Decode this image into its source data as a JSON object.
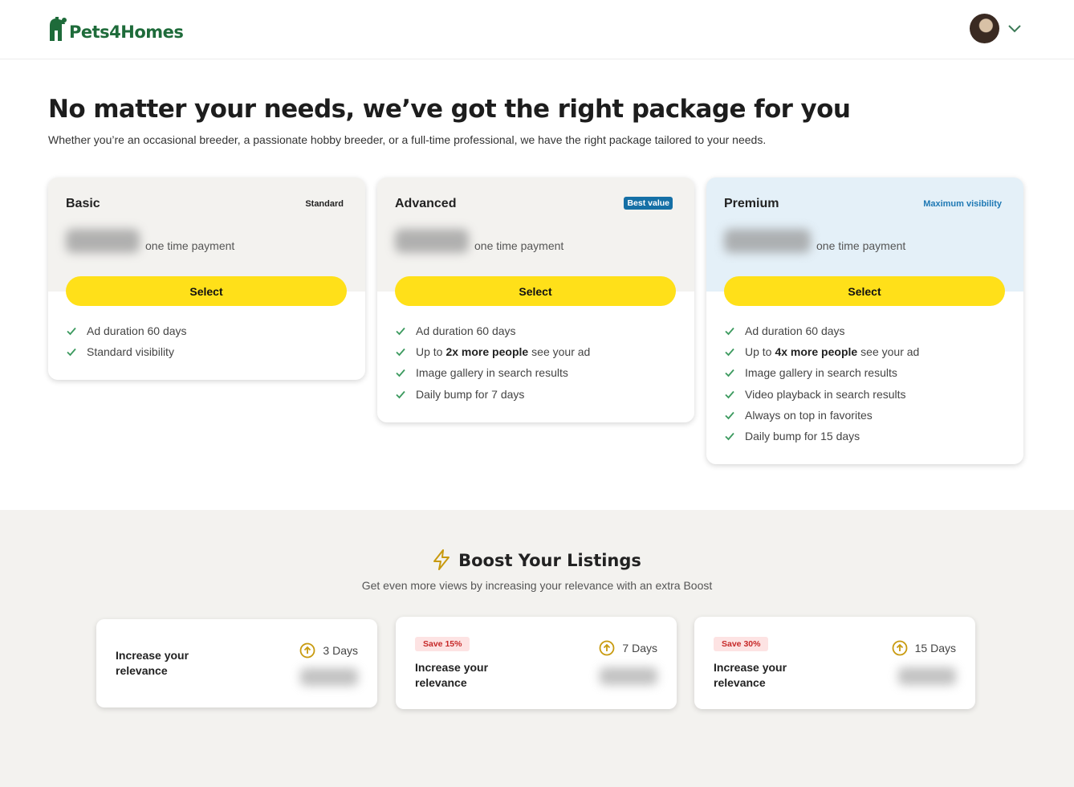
{
  "header": {
    "logo_text": "Pets4Homes",
    "account_menu_icon": "chevron-down-icon"
  },
  "hero": {
    "title": "No matter your needs, we’ve got the right package for you",
    "subtitle": "Whether you’re an occasional breeder, a passionate hobby breeder, or a full-time professional, we have the right package tailored to your needs."
  },
  "packages": [
    {
      "name": "Basic",
      "tag": "Standard",
      "price_note": "one time payment",
      "select_label": "Select",
      "features": [
        {
          "pre": "Ad duration 60 days",
          "bold": "",
          "post": ""
        },
        {
          "pre": "Standard visibility",
          "bold": "",
          "post": ""
        }
      ]
    },
    {
      "name": "Advanced",
      "tag": "Best value",
      "price_note": "one time payment",
      "select_label": "Select",
      "features": [
        {
          "pre": "Ad duration 60 days",
          "bold": "",
          "post": ""
        },
        {
          "pre": "Up to",
          "bold": "2x more people",
          "post": "see your ad"
        },
        {
          "pre": "Image gallery in search results",
          "bold": "",
          "post": ""
        },
        {
          "pre": "Daily bump for 7 days",
          "bold": "",
          "post": ""
        }
      ]
    },
    {
      "name": "Premium",
      "tag": "Maximum visibility",
      "price_note": "one time payment",
      "select_label": "Select",
      "features": [
        {
          "pre": "Ad duration 60 days",
          "bold": "",
          "post": ""
        },
        {
          "pre": "Up to",
          "bold": "4x more people",
          "post": "see your ad"
        },
        {
          "pre": "Image gallery in search results",
          "bold": "",
          "post": ""
        },
        {
          "pre": "Video playback in search results",
          "bold": "",
          "post": ""
        },
        {
          "pre": "Always on top in favorites",
          "bold": "",
          "post": ""
        },
        {
          "pre": "Daily bump for 15 days",
          "bold": "",
          "post": ""
        }
      ]
    }
  ],
  "boost": {
    "title": "Boost Your Listings",
    "subtitle": "Get even more views by increasing your relevance with an extra Boost",
    "options": [
      {
        "save": "",
        "label": "Increase your relevance",
        "days": "3 Days"
      },
      {
        "save": "Save 15%",
        "label": "Increase your relevance",
        "days": "7 Days"
      },
      {
        "save": "Save 30%",
        "label": "Increase your relevance",
        "days": "15 Days"
      }
    ]
  },
  "colors": {
    "brand_green": "#1e6b3a",
    "select_yellow": "#ffe019",
    "best_value_blue": "#1570a6",
    "check_green": "#3c9a5f",
    "boost_gold": "#c89a0e"
  }
}
